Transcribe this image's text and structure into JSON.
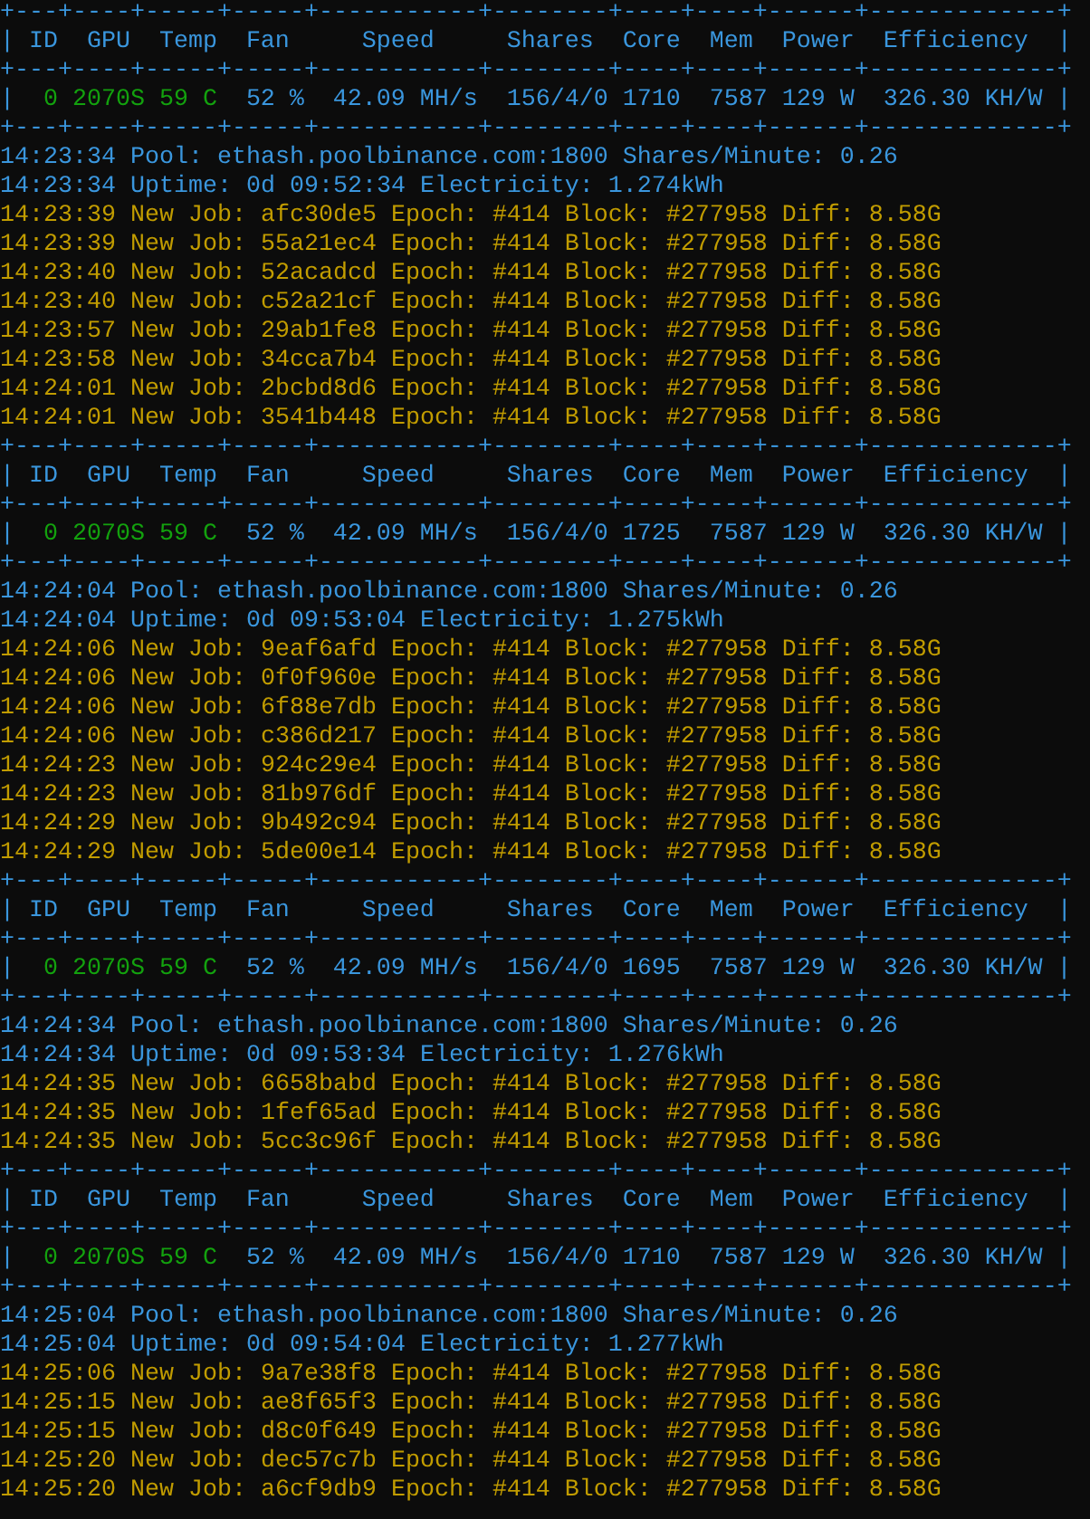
{
  "blocks": [
    {
      "table": {
        "borders": [
          "+---+----+-----+-----+-----------+--------+----+----+------+-------------+",
          "+---+----+-----+-----+-----------+--------+----+----+------+-------------+",
          "+---+----+-----+-----+-----------+--------+----+----+------+-------------+"
        ],
        "header": {
          "left": "|",
          "right": "|",
          "cells": [
            "ID",
            "GPU",
            "Temp",
            "Fan",
            "Speed",
            "Shares",
            "Core",
            "Mem",
            "Power",
            "Efficiency"
          ]
        },
        "row": {
          "left": "|",
          "right": "|",
          "cells": [
            {
              "text": "0",
              "color": "#13a10e"
            },
            {
              "text": "2070S",
              "color": "#13a10e"
            },
            {
              "text": "59 C",
              "color": "#13a10e"
            },
            {
              "text": "52 %",
              "color": "#3a96dd"
            },
            {
              "text": "42.09 MH/s",
              "color": "#3a96dd"
            },
            {
              "text": "156/4/0",
              "color": "#3a96dd"
            },
            {
              "text": "1710",
              "color": "#3a96dd"
            },
            {
              "text": "7587",
              "color": "#3a96dd"
            },
            {
              "text": "129 W",
              "color": "#3a96dd"
            },
            {
              "text": "326.30 KH/W",
              "color": "#3a96dd"
            }
          ]
        }
      },
      "log": [
        {
          "kind": "status",
          "text": "14:23:34 Pool: ethash.poolbinance.com:1800 Shares/Minute: 0.26"
        },
        {
          "kind": "status",
          "text": "14:23:34 Uptime: 0d 09:52:34 Electricity: 1.274kWh"
        },
        {
          "kind": "job",
          "text": "14:23:39 New Job: afc30de5 Epoch: #414 Block: #277958 Diff: 8.58G"
        },
        {
          "kind": "job",
          "text": "14:23:39 New Job: 55a21ec4 Epoch: #414 Block: #277958 Diff: 8.58G"
        },
        {
          "kind": "job",
          "text": "14:23:40 New Job: 52acadcd Epoch: #414 Block: #277958 Diff: 8.58G"
        },
        {
          "kind": "job",
          "text": "14:23:40 New Job: c52a21cf Epoch: #414 Block: #277958 Diff: 8.58G"
        },
        {
          "kind": "job",
          "text": "14:23:57 New Job: 29ab1fe8 Epoch: #414 Block: #277958 Diff: 8.58G"
        },
        {
          "kind": "job",
          "text": "14:23:58 New Job: 34cca7b4 Epoch: #414 Block: #277958 Diff: 8.58G"
        },
        {
          "kind": "job",
          "text": "14:24:01 New Job: 2bcbd8d6 Epoch: #414 Block: #277958 Diff: 8.58G"
        },
        {
          "kind": "job",
          "text": "14:24:01 New Job: 3541b448 Epoch: #414 Block: #277958 Diff: 8.58G"
        }
      ]
    },
    {
      "table": {
        "borders": [
          "+---+----+-----+-----+-----------+--------+----+----+------+-------------+",
          "+---+----+-----+-----+-----------+--------+----+----+------+-------------+",
          "+---+----+-----+-----+-----------+--------+----+----+------+-------------+"
        ],
        "header": {
          "left": "|",
          "right": "|",
          "cells": [
            "ID",
            "GPU",
            "Temp",
            "Fan",
            "Speed",
            "Shares",
            "Core",
            "Mem",
            "Power",
            "Efficiency"
          ]
        },
        "row": {
          "left": "|",
          "right": "|",
          "cells": [
            {
              "text": "0",
              "color": "#13a10e"
            },
            {
              "text": "2070S",
              "color": "#13a10e"
            },
            {
              "text": "59 C",
              "color": "#13a10e"
            },
            {
              "text": "52 %",
              "color": "#3a96dd"
            },
            {
              "text": "42.09 MH/s",
              "color": "#3a96dd"
            },
            {
              "text": "156/4/0",
              "color": "#3a96dd"
            },
            {
              "text": "1725",
              "color": "#3a96dd"
            },
            {
              "text": "7587",
              "color": "#3a96dd"
            },
            {
              "text": "129 W",
              "color": "#3a96dd"
            },
            {
              "text": "326.30 KH/W",
              "color": "#3a96dd"
            }
          ]
        }
      },
      "log": [
        {
          "kind": "status",
          "text": "14:24:04 Pool: ethash.poolbinance.com:1800 Shares/Minute: 0.26"
        },
        {
          "kind": "status",
          "text": "14:24:04 Uptime: 0d 09:53:04 Electricity: 1.275kWh"
        },
        {
          "kind": "job",
          "text": "14:24:06 New Job: 9eaf6afd Epoch: #414 Block: #277958 Diff: 8.58G"
        },
        {
          "kind": "job",
          "text": "14:24:06 New Job: 0f0f960e Epoch: #414 Block: #277958 Diff: 8.58G"
        },
        {
          "kind": "job",
          "text": "14:24:06 New Job: 6f88e7db Epoch: #414 Block: #277958 Diff: 8.58G"
        },
        {
          "kind": "job",
          "text": "14:24:06 New Job: c386d217 Epoch: #414 Block: #277958 Diff: 8.58G"
        },
        {
          "kind": "job",
          "text": "14:24:23 New Job: 924c29e4 Epoch: #414 Block: #277958 Diff: 8.58G"
        },
        {
          "kind": "job",
          "text": "14:24:23 New Job: 81b976df Epoch: #414 Block: #277958 Diff: 8.58G"
        },
        {
          "kind": "job",
          "text": "14:24:29 New Job: 9b492c94 Epoch: #414 Block: #277958 Diff: 8.58G"
        },
        {
          "kind": "job",
          "text": "14:24:29 New Job: 5de00e14 Epoch: #414 Block: #277958 Diff: 8.58G"
        }
      ]
    },
    {
      "table": {
        "borders": [
          "+---+----+-----+-----+-----------+--------+----+----+------+-------------+",
          "+---+----+-----+-----+-----------+--------+----+----+------+-------------+",
          "+---+----+-----+-----+-----------+--------+----+----+------+-------------+"
        ],
        "header": {
          "left": "|",
          "right": "|",
          "cells": [
            "ID",
            "GPU",
            "Temp",
            "Fan",
            "Speed",
            "Shares",
            "Core",
            "Mem",
            "Power",
            "Efficiency"
          ]
        },
        "row": {
          "left": "|",
          "right": "|",
          "cells": [
            {
              "text": "0",
              "color": "#13a10e"
            },
            {
              "text": "2070S",
              "color": "#13a10e"
            },
            {
              "text": "59 C",
              "color": "#13a10e"
            },
            {
              "text": "52 %",
              "color": "#3a96dd"
            },
            {
              "text": "42.09 MH/s",
              "color": "#3a96dd"
            },
            {
              "text": "156/4/0",
              "color": "#3a96dd"
            },
            {
              "text": "1695",
              "color": "#3a96dd"
            },
            {
              "text": "7587",
              "color": "#3a96dd"
            },
            {
              "text": "129 W",
              "color": "#3a96dd"
            },
            {
              "text": "326.30 KH/W",
              "color": "#3a96dd"
            }
          ]
        }
      },
      "log": [
        {
          "kind": "status",
          "text": "14:24:34 Pool: ethash.poolbinance.com:1800 Shares/Minute: 0.26"
        },
        {
          "kind": "status",
          "text": "14:24:34 Uptime: 0d 09:53:34 Electricity: 1.276kWh"
        },
        {
          "kind": "job",
          "text": "14:24:35 New Job: 6658babd Epoch: #414 Block: #277958 Diff: 8.58G"
        },
        {
          "kind": "job",
          "text": "14:24:35 New Job: 1fef65ad Epoch: #414 Block: #277958 Diff: 8.58G"
        },
        {
          "kind": "job",
          "text": "14:24:35 New Job: 5cc3c96f Epoch: #414 Block: #277958 Diff: 8.58G"
        }
      ]
    },
    {
      "table": {
        "borders": [
          "+---+----+-----+-----+-----------+--------+----+----+------+-------------+",
          "+---+----+-----+-----+-----------+--------+----+----+------+-------------+",
          "+---+----+-----+-----+-----------+--------+----+----+------+-------------+"
        ],
        "header": {
          "left": "|",
          "right": "|",
          "cells": [
            "ID",
            "GPU",
            "Temp",
            "Fan",
            "Speed",
            "Shares",
            "Core",
            "Mem",
            "Power",
            "Efficiency"
          ]
        },
        "row": {
          "left": "|",
          "right": "|",
          "cells": [
            {
              "text": "0",
              "color": "#13a10e"
            },
            {
              "text": "2070S",
              "color": "#13a10e"
            },
            {
              "text": "59 C",
              "color": "#13a10e"
            },
            {
              "text": "52 %",
              "color": "#3a96dd"
            },
            {
              "text": "42.09 MH/s",
              "color": "#3a96dd"
            },
            {
              "text": "156/4/0",
              "color": "#3a96dd"
            },
            {
              "text": "1710",
              "color": "#3a96dd"
            },
            {
              "text": "7587",
              "color": "#3a96dd"
            },
            {
              "text": "129 W",
              "color": "#3a96dd"
            },
            {
              "text": "326.30 KH/W",
              "color": "#3a96dd"
            }
          ]
        }
      },
      "log": [
        {
          "kind": "status",
          "text": "14:25:04 Pool: ethash.poolbinance.com:1800 Shares/Minute: 0.26"
        },
        {
          "kind": "status",
          "text": "14:25:04 Uptime: 0d 09:54:04 Electricity: 1.277kWh"
        },
        {
          "kind": "job",
          "text": "14:25:06 New Job: 9a7e38f8 Epoch: #414 Block: #277958 Diff: 8.58G"
        },
        {
          "kind": "job",
          "text": "14:25:15 New Job: ae8f65f3 Epoch: #414 Block: #277958 Diff: 8.58G"
        },
        {
          "kind": "job",
          "text": "14:25:15 New Job: d8c0f649 Epoch: #414 Block: #277958 Diff: 8.58G"
        },
        {
          "kind": "job",
          "text": "14:25:20 New Job: dec57c7b Epoch: #414 Block: #277958 Diff: 8.58G"
        },
        {
          "kind": "job",
          "text": "14:25:20 New Job: a6cf9db9 Epoch: #414 Block: #277958 Diff: 8.58G"
        }
      ]
    }
  ]
}
